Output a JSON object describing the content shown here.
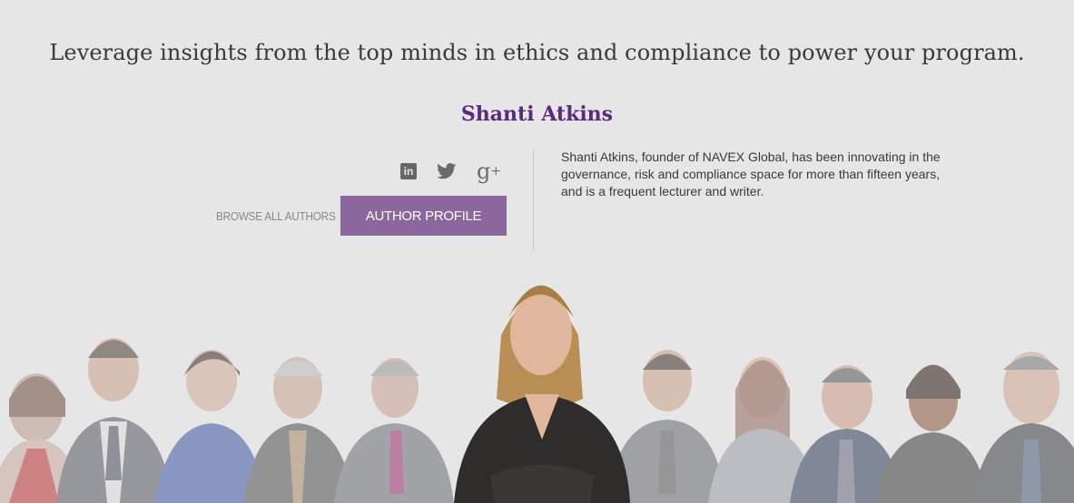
{
  "headline": "Leverage insights from the top minds in ethics and compliance to power your program.",
  "author": {
    "name": "Shanti Atkins",
    "bio": "Shanti Atkins, founder of NAVEX Global, has been innovating in the governance, risk and compliance space for more than fifteen years, and is a frequent lecturer and writer."
  },
  "social": {
    "linkedin": "in",
    "gplus": "g"
  },
  "actions": {
    "browse_label": "BROWSE ALL AUTHORS",
    "profile_label": "AUTHOR PROFILE"
  },
  "colors": {
    "background": "#e6e6e6",
    "name": "#5a2a7e",
    "button": "#8b679e"
  },
  "icons": [
    "linkedin-icon",
    "twitter-icon",
    "google-plus-icon"
  ]
}
